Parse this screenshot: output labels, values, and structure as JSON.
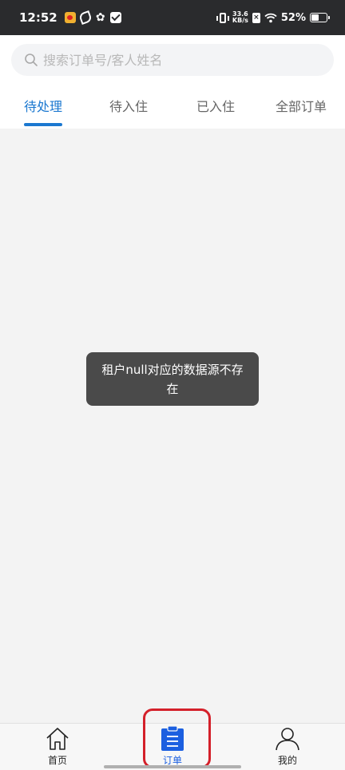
{
  "status_bar": {
    "time": "12:52",
    "net_speed_value": "33.6",
    "net_speed_unit": "KB/s",
    "battery": "52%"
  },
  "search": {
    "placeholder": "搜索订单号/客人姓名",
    "value": ""
  },
  "tabs": [
    {
      "label": "待处理",
      "active": true
    },
    {
      "label": "待入住",
      "active": false
    },
    {
      "label": "已入住",
      "active": false
    },
    {
      "label": "全部订单",
      "active": false
    }
  ],
  "toast": {
    "message": "租户null对应的数据源不存在"
  },
  "bottom_nav": [
    {
      "label": "首页",
      "icon": "home-icon",
      "active": false
    },
    {
      "label": "订单",
      "icon": "orders-icon",
      "active": true
    },
    {
      "label": "我的",
      "icon": "profile-icon",
      "active": false
    }
  ],
  "colors": {
    "accent": "#1b78d0",
    "status_bar_bg": "#2a2b2d",
    "content_bg": "#f3f3f3",
    "toast_bg": "#4a4a4a",
    "highlight": "#d4202a"
  }
}
